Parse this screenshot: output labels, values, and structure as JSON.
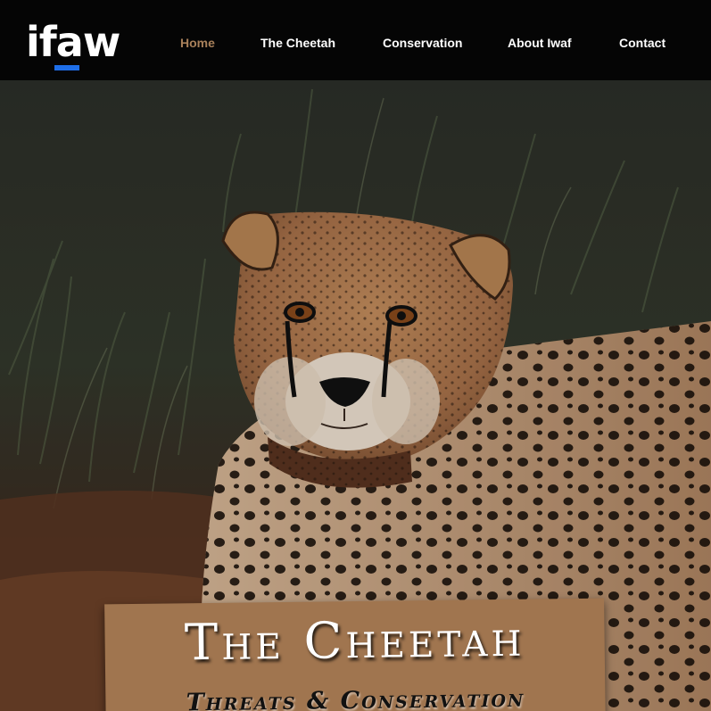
{
  "header": {
    "logo": "ifaw",
    "nav": [
      {
        "label": "Home",
        "active": true
      },
      {
        "label": "The Cheetah",
        "active": false
      },
      {
        "label": "Conservation",
        "active": false
      },
      {
        "label": "About Iwaf",
        "active": false
      },
      {
        "label": "Contact",
        "active": false
      }
    ]
  },
  "hero": {
    "title": "The Cheetah",
    "subtitle": "Threats & Conservation"
  },
  "colors": {
    "header_bg": "#050505",
    "nav_active": "#a8805a",
    "logo_accent": "#1e6ee8",
    "plate": "#a0754f"
  }
}
